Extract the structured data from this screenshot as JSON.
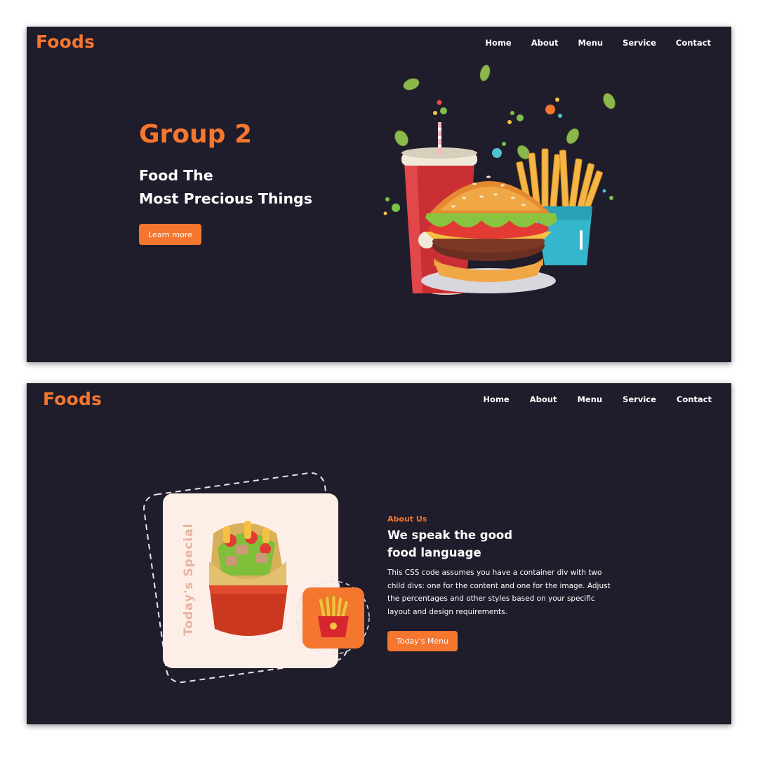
{
  "hero_page": {
    "logo": "Foods",
    "nav": [
      "Home",
      "About",
      "Menu",
      "Service",
      "Contact"
    ],
    "title": "Group 2",
    "subtitle_lines": [
      "Food The",
      "Most Precious Things"
    ],
    "cta_label": "Learn more"
  },
  "about_page": {
    "logo": "Foods",
    "nav": [
      "Home",
      "About",
      "Menu",
      "Service",
      "Contact"
    ],
    "badge_vertical": "Today's Special",
    "label": "About Us",
    "title_lines": [
      "We speak the good",
      "food language"
    ],
    "body": "This CSS code assumes you have a container div with two child divs: one for the content and one for the image. Adjust the percentages and other styles based on your specific layout and design requirements.",
    "cta_label": "Today's Menu"
  },
  "colors": {
    "background": "#1f1c2b",
    "accent": "#f4762f",
    "text": "#ffffff",
    "card": "#fdeee8"
  },
  "icons": [
    "burger-illustration",
    "fries-illustration",
    "soda-cup-illustration",
    "burrito-illustration",
    "fries-badge-icon"
  ]
}
